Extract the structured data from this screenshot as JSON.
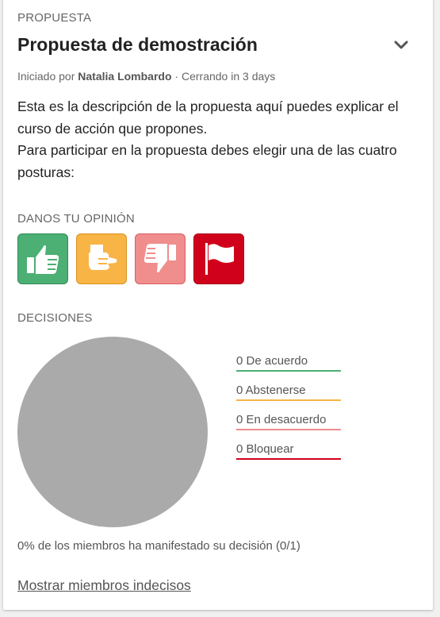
{
  "proposal": {
    "section_label": "PROPUESTA",
    "title": "Propuesta de demostración",
    "started_by_prefix": "Iniciado por",
    "author": "Natalia Lombardo",
    "closing": "· Cerrando in 3 days",
    "description": [
      "Esta es la descripción de la propuesta aquí puedes explicar el curso de acción que propones.",
      "Para participar en la propuesta debes elegir una de las cuatro posturas:"
    ]
  },
  "opinion": {
    "label": "DANOS TU OPINIÓN",
    "buttons": [
      {
        "name": "agree",
        "icon": "thumbs-up-icon",
        "color": "#4caf73"
      },
      {
        "name": "abstain",
        "icon": "hand-flat-icon",
        "color": "#f8b445"
      },
      {
        "name": "disagree",
        "icon": "thumbs-down-icon",
        "color": "#f08d8d"
      },
      {
        "name": "block",
        "icon": "flag-icon",
        "color": "#d0021b"
      }
    ]
  },
  "decisions": {
    "label": "DECISIONES",
    "legend": [
      {
        "text": "0 De acuerdo",
        "color": "#4caf73"
      },
      {
        "text": "0 Abstenerse",
        "color": "#f8b445"
      },
      {
        "text": "0 En desacuerdo",
        "color": "#f08d8d"
      },
      {
        "text": "0 Bloquear",
        "color": "#d0021b"
      }
    ],
    "summary": "0% de los miembros ha manifestado su decisión (0/1)",
    "show_undecided_link": "Mostrar miembros indecisos",
    "empty_pie_color": "#aaaaaa"
  }
}
